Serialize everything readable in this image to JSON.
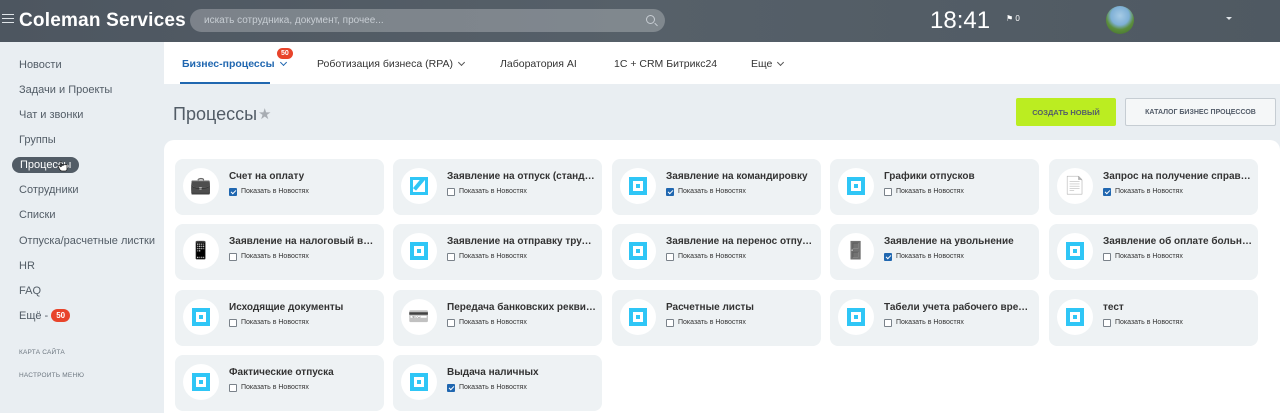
{
  "header": {
    "brand": "Coleman Services",
    "search_placeholder": "искать сотрудника, документ, прочее...",
    "time": "18:41",
    "flag_count": "0"
  },
  "sidebar": {
    "items": [
      {
        "label": "Новости"
      },
      {
        "label": "Задачи и Проекты"
      },
      {
        "label": "Чат и звонки"
      },
      {
        "label": "Группы"
      },
      {
        "label": "Процессы"
      },
      {
        "label": "Сотрудники"
      },
      {
        "label": "Списки"
      },
      {
        "label": "Отпуска/расчетные листки"
      },
      {
        "label": "HR"
      },
      {
        "label": "FAQ"
      },
      {
        "label": "Ещё -",
        "badge": "50"
      }
    ],
    "links": [
      "КАРТА САЙТА",
      "НАСТРОИТЬ МЕНЮ"
    ]
  },
  "tabs": [
    {
      "label": "Бизнес-процессы",
      "badge": "50"
    },
    {
      "label": "Роботизация бизнеса (RPA)"
    },
    {
      "label": "Лаборатория AI"
    },
    {
      "label": "1С + CRM Битрикс24"
    },
    {
      "label": "Еще"
    }
  ],
  "page": {
    "title": "Процессы",
    "create_button": "СОЗДАТЬ НОВЫЙ",
    "catalog_button": "КАТАЛОГ БИЗНЕС ПРОЦЕССОВ"
  },
  "checkbox_label": "Показать в Новостях",
  "processes": [
    {
      "title": "Счет на оплату",
      "checked": true,
      "icon": "briefcase-gear-icon"
    },
    {
      "title": "Заявление на отпуск (стандар...",
      "checked": false,
      "icon": "edit-icon"
    },
    {
      "title": "Заявление на командировку",
      "checked": true,
      "icon": "square-icon"
    },
    {
      "title": "Графики отпусков",
      "checked": false,
      "icon": "square-icon"
    },
    {
      "title": "Запрос на получение справки...",
      "checked": true,
      "icon": "document-gear-icon"
    },
    {
      "title": "Заявление на налоговый выч...",
      "checked": false,
      "icon": "phone-receipt-icon"
    },
    {
      "title": "Заявление на отправку трудо...",
      "checked": false,
      "icon": "square-icon"
    },
    {
      "title": "Заявление на перенос отпуска",
      "checked": false,
      "icon": "square-icon"
    },
    {
      "title": "Заявление на увольнение",
      "checked": true,
      "icon": "exit-door-icon"
    },
    {
      "title": "Заявление об оплате больни...",
      "checked": false,
      "icon": "square-icon"
    },
    {
      "title": "Исходящие документы",
      "checked": false,
      "icon": "square-icon"
    },
    {
      "title": "Передача банковских реквиз...",
      "checked": false,
      "icon": "bank-card-icon"
    },
    {
      "title": "Расчетные листы",
      "checked": false,
      "icon": "square-icon"
    },
    {
      "title": "Табели учета рабочего време...",
      "checked": false,
      "icon": "square-icon"
    },
    {
      "title": "тест",
      "checked": false,
      "icon": "square-icon"
    },
    {
      "title": "Фактические отпуска",
      "checked": false,
      "icon": "square-icon"
    },
    {
      "title": "Выдача наличных",
      "checked": true,
      "icon": "square-icon"
    }
  ]
}
